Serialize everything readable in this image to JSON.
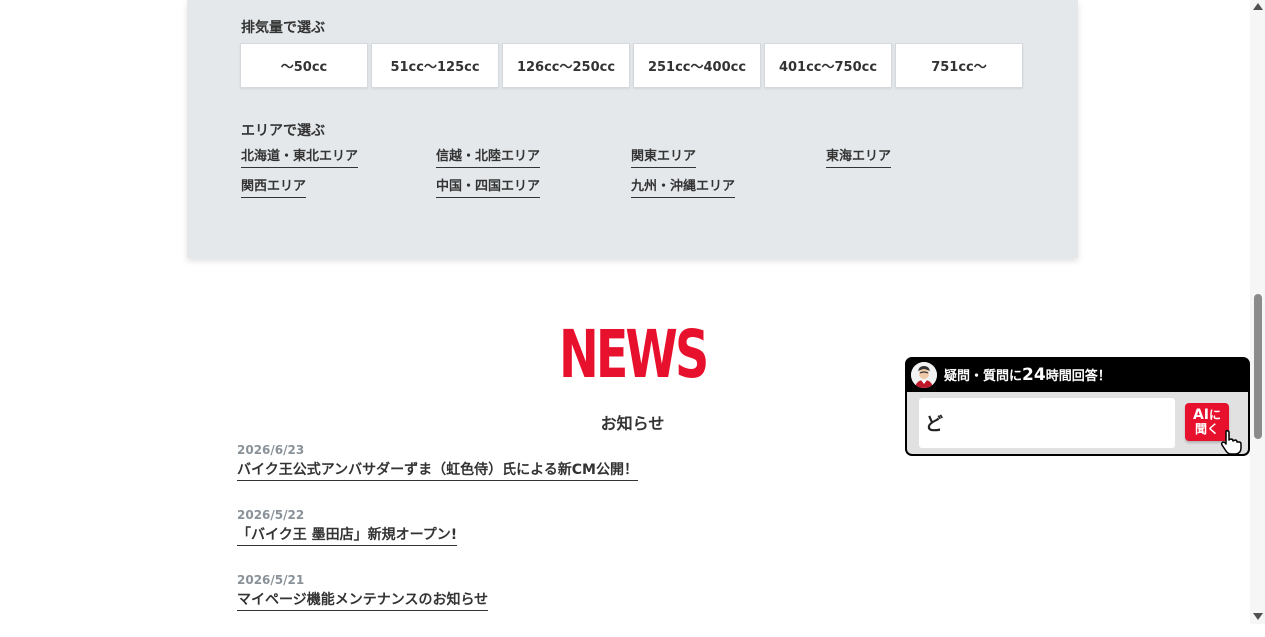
{
  "search": {
    "displacement_heading": "排気量で選ぶ",
    "displacement_options": [
      "〜50cc",
      "51cc〜125cc",
      "126cc〜250cc",
      "251cc〜400cc",
      "401cc〜750cc",
      "751cc〜"
    ],
    "area_heading": "エリアで選ぶ",
    "areas": [
      "北海道・東北エリア",
      "信越・北陸エリア",
      "関東エリア",
      "東海エリア",
      "関西エリア",
      "中国・四国エリア",
      "九州・沖縄エリア"
    ]
  },
  "news": {
    "title": "NEWS",
    "subtitle": "お知らせ",
    "items": [
      {
        "date": "2026/6/23",
        "title": "バイク王公式アンバサダーずま（虹色侍）氏による新CM公開！"
      },
      {
        "date": "2026/5/22",
        "title": "「バイク王 墨田店」新規オープン!"
      },
      {
        "date": "2026/5/21",
        "title": "マイページ機能メンテナンスのお知らせ"
      }
    ]
  },
  "ai_widget": {
    "header_prefix": "疑問・質問に",
    "header_number": "24",
    "header_suffix": "時間回答！",
    "input_value": "ど",
    "button_line1_a": "AI",
    "button_line1_b": "に",
    "button_line2": "聞く"
  },
  "colors": {
    "accent_red": "#e8112d",
    "panel_bg": "#e5e8eb",
    "text": "#333333",
    "date_gray": "#8a9299"
  },
  "icons": {
    "avatar": "staff-avatar-icon",
    "cursor": "hand-cursor-icon"
  }
}
